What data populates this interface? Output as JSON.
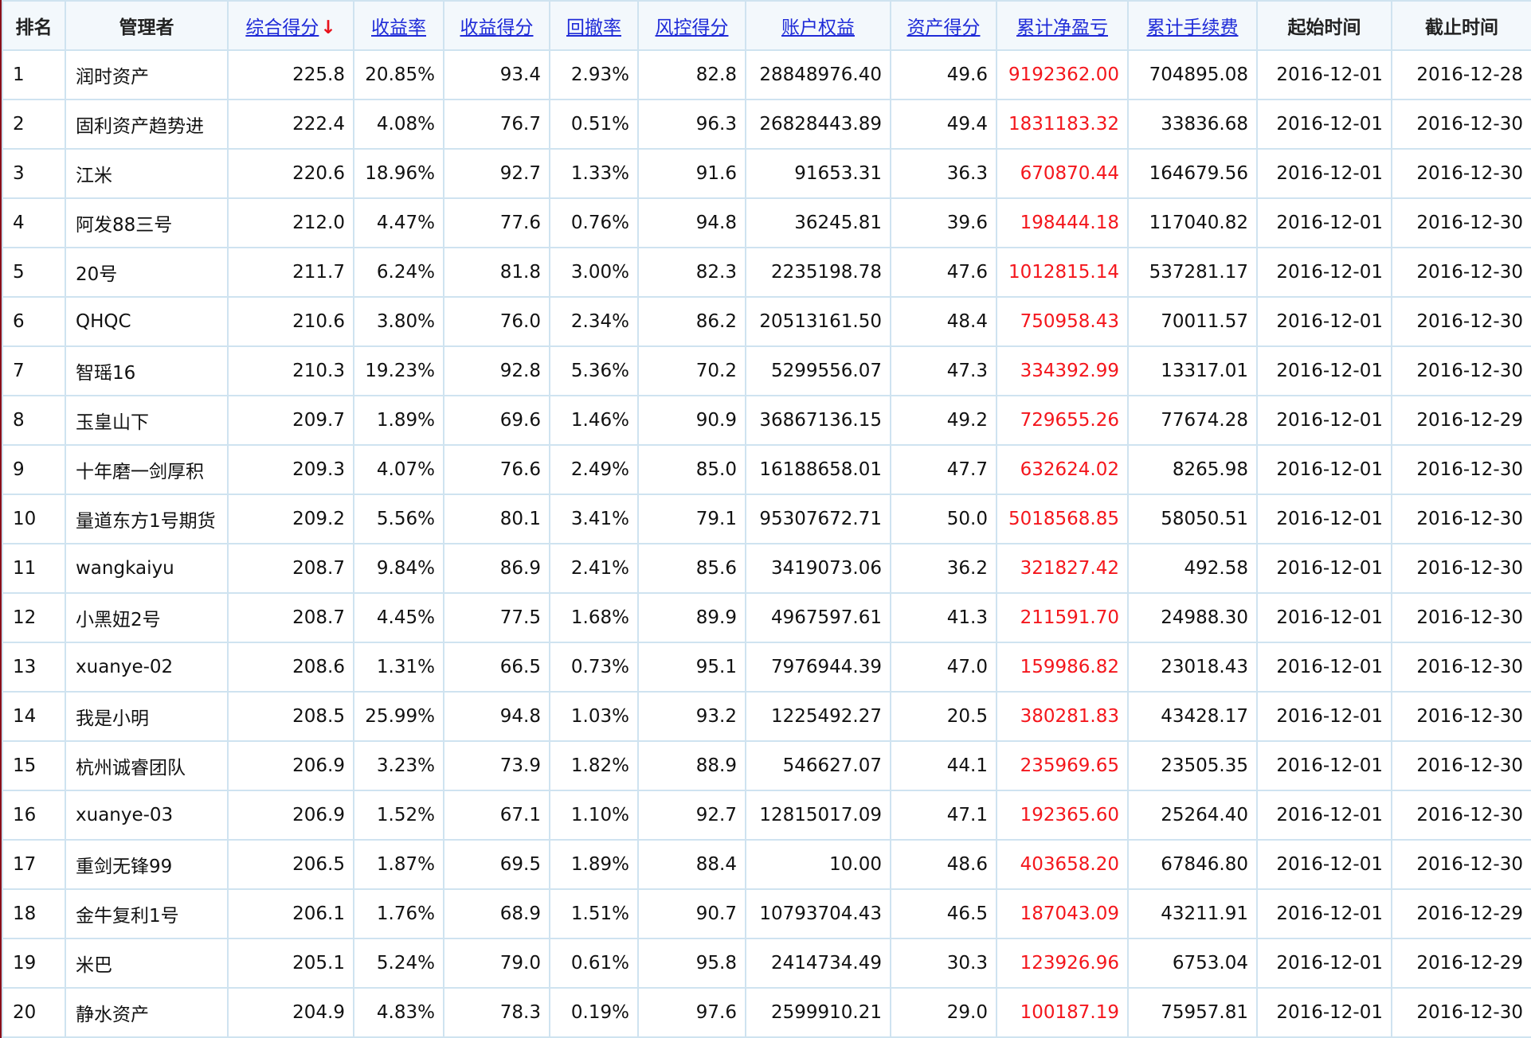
{
  "table": {
    "columns": [
      {
        "key": "rank",
        "label": "排名",
        "sortable": false
      },
      {
        "key": "manager",
        "label": "管理者",
        "sortable": false
      },
      {
        "key": "score",
        "label": "综合得分",
        "sortable": true,
        "sort_indicator": "↓"
      },
      {
        "key": "return_rate",
        "label": "收益率",
        "sortable": true
      },
      {
        "key": "return_score",
        "label": "收益得分",
        "sortable": true
      },
      {
        "key": "drawdown",
        "label": "回撤率",
        "sortable": true
      },
      {
        "key": "risk_score",
        "label": "风控得分",
        "sortable": true
      },
      {
        "key": "equity",
        "label": "账户权益",
        "sortable": true
      },
      {
        "key": "asset_score",
        "label": "资产得分",
        "sortable": true
      },
      {
        "key": "net_pnl",
        "label": "累计净盈亏",
        "sortable": true
      },
      {
        "key": "fees",
        "label": "累计手续费",
        "sortable": true
      },
      {
        "key": "start",
        "label": "起始时间",
        "sortable": false
      },
      {
        "key": "end",
        "label": "截止时间",
        "sortable": false
      }
    ],
    "pnl_color": "#f4161c",
    "link_color": "#1f2bd8",
    "rows": [
      {
        "rank": "1",
        "manager": "润时资产",
        "score": "225.8",
        "return_rate": "20.85%",
        "return_score": "93.4",
        "drawdown": "2.93%",
        "risk_score": "82.8",
        "equity": "28848976.40",
        "asset_score": "49.6",
        "net_pnl": "9192362.00",
        "fees": "704895.08",
        "start": "2016-12-01",
        "end": "2016-12-28"
      },
      {
        "rank": "2",
        "manager": "固利资产趋势进",
        "score": "222.4",
        "return_rate": "4.08%",
        "return_score": "76.7",
        "drawdown": "0.51%",
        "risk_score": "96.3",
        "equity": "26828443.89",
        "asset_score": "49.4",
        "net_pnl": "1831183.32",
        "fees": "33836.68",
        "start": "2016-12-01",
        "end": "2016-12-30"
      },
      {
        "rank": "3",
        "manager": "江米",
        "score": "220.6",
        "return_rate": "18.96%",
        "return_score": "92.7",
        "drawdown": "1.33%",
        "risk_score": "91.6",
        "equity": "91653.31",
        "asset_score": "36.3",
        "net_pnl": "670870.44",
        "fees": "164679.56",
        "start": "2016-12-01",
        "end": "2016-12-30"
      },
      {
        "rank": "4",
        "manager": "阿发88三号",
        "score": "212.0",
        "return_rate": "4.47%",
        "return_score": "77.6",
        "drawdown": "0.76%",
        "risk_score": "94.8",
        "equity": "36245.81",
        "asset_score": "39.6",
        "net_pnl": "198444.18",
        "fees": "117040.82",
        "start": "2016-12-01",
        "end": "2016-12-30"
      },
      {
        "rank": "5",
        "manager": "20号",
        "score": "211.7",
        "return_rate": "6.24%",
        "return_score": "81.8",
        "drawdown": "3.00%",
        "risk_score": "82.3",
        "equity": "2235198.78",
        "asset_score": "47.6",
        "net_pnl": "1012815.14",
        "fees": "537281.17",
        "start": "2016-12-01",
        "end": "2016-12-30"
      },
      {
        "rank": "6",
        "manager": "QHQC",
        "score": "210.6",
        "return_rate": "3.80%",
        "return_score": "76.0",
        "drawdown": "2.34%",
        "risk_score": "86.2",
        "equity": "20513161.50",
        "asset_score": "48.4",
        "net_pnl": "750958.43",
        "fees": "70011.57",
        "start": "2016-12-01",
        "end": "2016-12-30"
      },
      {
        "rank": "7",
        "manager": "智瑶16",
        "score": "210.3",
        "return_rate": "19.23%",
        "return_score": "92.8",
        "drawdown": "5.36%",
        "risk_score": "70.2",
        "equity": "5299556.07",
        "asset_score": "47.3",
        "net_pnl": "334392.99",
        "fees": "13317.01",
        "start": "2016-12-01",
        "end": "2016-12-30"
      },
      {
        "rank": "8",
        "manager": "玉皇山下",
        "score": "209.7",
        "return_rate": "1.89%",
        "return_score": "69.6",
        "drawdown": "1.46%",
        "risk_score": "90.9",
        "equity": "36867136.15",
        "asset_score": "49.2",
        "net_pnl": "729655.26",
        "fees": "77674.28",
        "start": "2016-12-01",
        "end": "2016-12-29"
      },
      {
        "rank": "9",
        "manager": "十年磨一剑厚积",
        "score": "209.3",
        "return_rate": "4.07%",
        "return_score": "76.6",
        "drawdown": "2.49%",
        "risk_score": "85.0",
        "equity": "16188658.01",
        "asset_score": "47.7",
        "net_pnl": "632624.02",
        "fees": "8265.98",
        "start": "2016-12-01",
        "end": "2016-12-30"
      },
      {
        "rank": "10",
        "manager": "量道东方1号期货",
        "score": "209.2",
        "return_rate": "5.56%",
        "return_score": "80.1",
        "drawdown": "3.41%",
        "risk_score": "79.1",
        "equity": "95307672.71",
        "asset_score": "50.0",
        "net_pnl": "5018568.85",
        "fees": "58050.51",
        "start": "2016-12-01",
        "end": "2016-12-30"
      },
      {
        "rank": "11",
        "manager": "wangkaiyu",
        "score": "208.7",
        "return_rate": "9.84%",
        "return_score": "86.9",
        "drawdown": "2.41%",
        "risk_score": "85.6",
        "equity": "3419073.06",
        "asset_score": "36.2",
        "net_pnl": "321827.42",
        "fees": "492.58",
        "start": "2016-12-01",
        "end": "2016-12-30"
      },
      {
        "rank": "12",
        "manager": "小黑妞2号",
        "score": "208.7",
        "return_rate": "4.45%",
        "return_score": "77.5",
        "drawdown": "1.68%",
        "risk_score": "89.9",
        "equity": "4967597.61",
        "asset_score": "41.3",
        "net_pnl": "211591.70",
        "fees": "24988.30",
        "start": "2016-12-01",
        "end": "2016-12-30"
      },
      {
        "rank": "13",
        "manager": "xuanye-02",
        "score": "208.6",
        "return_rate": "1.31%",
        "return_score": "66.5",
        "drawdown": "0.73%",
        "risk_score": "95.1",
        "equity": "7976944.39",
        "asset_score": "47.0",
        "net_pnl": "159986.82",
        "fees": "23018.43",
        "start": "2016-12-01",
        "end": "2016-12-30"
      },
      {
        "rank": "14",
        "manager": "我是小明",
        "score": "208.5",
        "return_rate": "25.99%",
        "return_score": "94.8",
        "drawdown": "1.03%",
        "risk_score": "93.2",
        "equity": "1225492.27",
        "asset_score": "20.5",
        "net_pnl": "380281.83",
        "fees": "43428.17",
        "start": "2016-12-01",
        "end": "2016-12-30"
      },
      {
        "rank": "15",
        "manager": "杭州诚睿团队",
        "score": "206.9",
        "return_rate": "3.23%",
        "return_score": "73.9",
        "drawdown": "1.82%",
        "risk_score": "88.9",
        "equity": "546627.07",
        "asset_score": "44.1",
        "net_pnl": "235969.65",
        "fees": "23505.35",
        "start": "2016-12-01",
        "end": "2016-12-30"
      },
      {
        "rank": "16",
        "manager": "xuanye-03",
        "score": "206.9",
        "return_rate": "1.52%",
        "return_score": "67.1",
        "drawdown": "1.10%",
        "risk_score": "92.7",
        "equity": "12815017.09",
        "asset_score": "47.1",
        "net_pnl": "192365.60",
        "fees": "25264.40",
        "start": "2016-12-01",
        "end": "2016-12-30"
      },
      {
        "rank": "17",
        "manager": "重剑无锋99",
        "score": "206.5",
        "return_rate": "1.87%",
        "return_score": "69.5",
        "drawdown": "1.89%",
        "risk_score": "88.4",
        "equity": "10.00",
        "asset_score": "48.6",
        "net_pnl": "403658.20",
        "fees": "67846.80",
        "start": "2016-12-01",
        "end": "2016-12-30"
      },
      {
        "rank": "18",
        "manager": "金牛复利1号",
        "score": "206.1",
        "return_rate": "1.76%",
        "return_score": "68.9",
        "drawdown": "1.51%",
        "risk_score": "90.7",
        "equity": "10793704.43",
        "asset_score": "46.5",
        "net_pnl": "187043.09",
        "fees": "43211.91",
        "start": "2016-12-01",
        "end": "2016-12-29"
      },
      {
        "rank": "19",
        "manager": "米巴",
        "score": "205.1",
        "return_rate": "5.24%",
        "return_score": "79.0",
        "drawdown": "0.61%",
        "risk_score": "95.8",
        "equity": "2414734.49",
        "asset_score": "30.3",
        "net_pnl": "123926.96",
        "fees": "6753.04",
        "start": "2016-12-01",
        "end": "2016-12-29"
      },
      {
        "rank": "20",
        "manager": "静水资产",
        "score": "204.9",
        "return_rate": "4.83%",
        "return_score": "78.3",
        "drawdown": "0.19%",
        "risk_score": "97.6",
        "equity": "2599910.21",
        "asset_score": "29.0",
        "net_pnl": "100187.19",
        "fees": "75957.81",
        "start": "2016-12-01",
        "end": "2016-12-30"
      }
    ]
  }
}
